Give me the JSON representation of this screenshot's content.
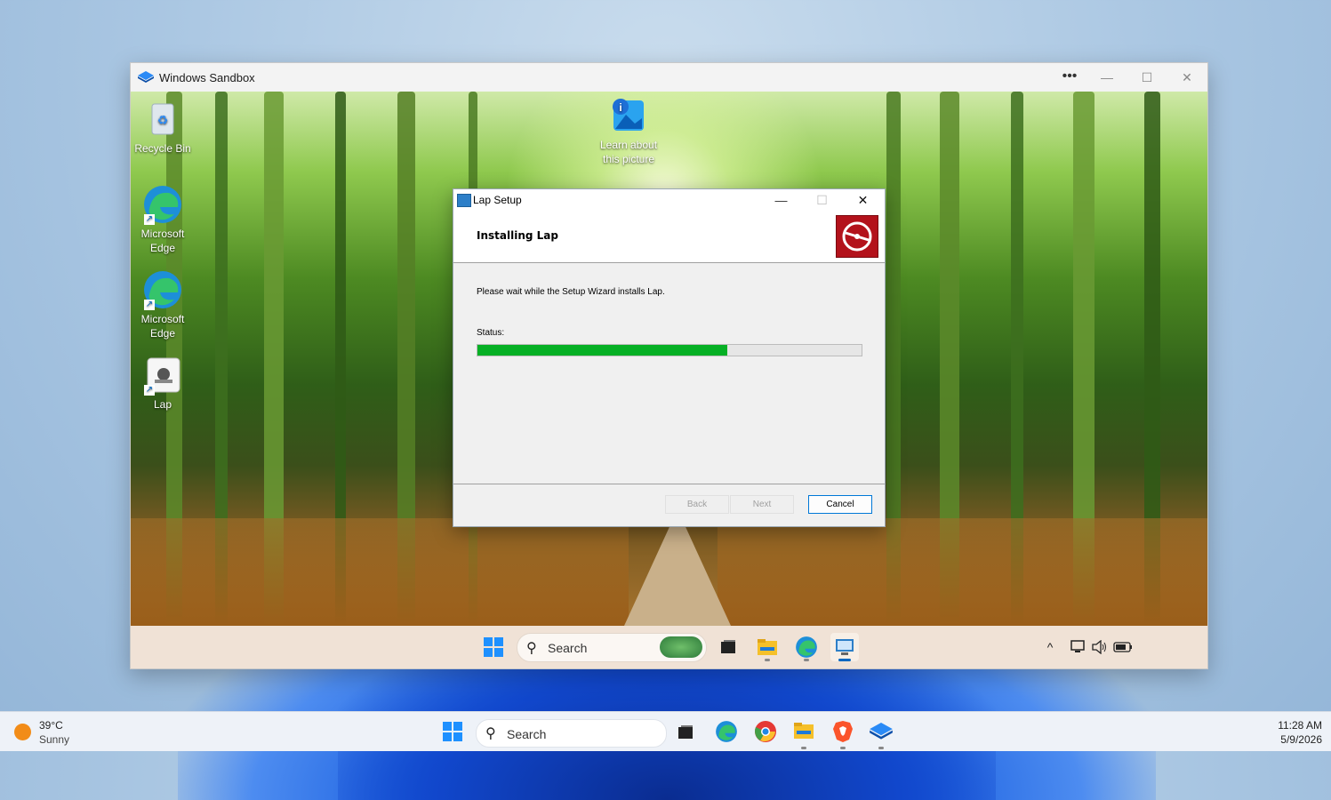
{
  "sandbox": {
    "title": "Windows Sandbox",
    "more_label": "•••",
    "min_label": "—",
    "max_label": "☐",
    "close_label": "✕"
  },
  "desktop_icons": [
    {
      "label": "Recycle Bin",
      "icon": "recycle-bin-icon"
    },
    {
      "label": "Learn about this picture",
      "icon": "learn-about-picture-icon"
    },
    {
      "label": "Microsoft Edge",
      "icon": "edge-icon"
    },
    {
      "label": "Microsoft Edge",
      "icon": "edge-icon"
    },
    {
      "label": "Lap",
      "icon": "lap-installer-icon"
    }
  ],
  "dialog": {
    "title": "Lap Setup",
    "heading": "Installing Lap",
    "message": "Please wait while the Setup Wizard installs Lap.",
    "status_label": "Status:",
    "progress": 0.65,
    "back_label": "Back",
    "next_label": "Next",
    "cancel_label": "Cancel",
    "min_label": "—",
    "max_label": "☐",
    "close_label": "✕",
    "logo_color": "#b3121b"
  },
  "sandbox_taskbar": {
    "search_placeholder": "Search",
    "icons": [
      "start-icon",
      "search-icon",
      "task-view-icon",
      "file-explorer-icon",
      "edge-icon",
      "setup-icon"
    ],
    "tray": {
      "chevron": "^",
      "icons": [
        "network-icon",
        "volume-icon",
        "battery-icon"
      ]
    }
  },
  "host_taskbar": {
    "weather_temp": "39°C",
    "weather_desc": "Sunny",
    "search_placeholder": "Search",
    "time": "11:28 AM",
    "date": "5/9/2026",
    "icons": [
      "start-icon",
      "task-view-icon",
      "edge-icon",
      "chrome-icon",
      "file-explorer-icon",
      "brave-icon",
      "sandbox-icon"
    ]
  }
}
